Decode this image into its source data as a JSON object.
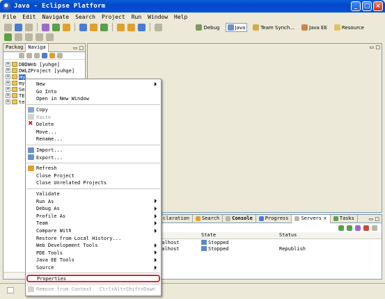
{
  "window": {
    "title": "Java - Eclipse Platform"
  },
  "menubar": [
    "File",
    "Edit",
    "Navigate",
    "Search",
    "Project",
    "Run",
    "Window",
    "Help"
  ],
  "perspectives": [
    {
      "label": "Debug",
      "active": false
    },
    {
      "label": "Java",
      "active": true
    },
    {
      "label": "Team Synch...",
      "active": false
    },
    {
      "label": "Java EE",
      "active": false
    },
    {
      "label": "Resource",
      "active": false
    }
  ],
  "left_panel": {
    "tabs": [
      "Packag",
      "Naviga"
    ],
    "tree": [
      {
        "label": "DBDWeb  [yuhge]"
      },
      {
        "label": "DWLZProject  [yuhge]"
      },
      {
        "label": "my"
      },
      {
        "label": "my"
      },
      {
        "label": "Se"
      },
      {
        "label": "TE"
      },
      {
        "label": "te"
      }
    ]
  },
  "bottom_panel": {
    "tabs": [
      {
        "label": "claration",
        "active": false
      },
      {
        "label": "Search",
        "active": false
      },
      {
        "label": "Console",
        "active": false
      },
      {
        "label": "Progress",
        "active": false
      },
      {
        "label": "Servers",
        "active": true
      },
      {
        "label": "Tasks",
        "active": false
      }
    ],
    "columns": [
      "",
      "State",
      "Status"
    ],
    "rows": [
      {
        "server": "calhost",
        "state": "Stopped",
        "status": ""
      },
      {
        "server": "calhost",
        "state": "Stopped",
        "status": "Republish"
      }
    ]
  },
  "context_menu": {
    "g1": {
      "new": "New",
      "go_into": "Go Into",
      "open_new_window": "Open in New Window"
    },
    "g2": {
      "copy": "Copy",
      "paste": "Paste",
      "delete": "Delete",
      "move": "Move...",
      "rename": "Rename..."
    },
    "g3": {
      "import": "Import...",
      "export": "Export..."
    },
    "g4": {
      "refresh": "Refresh",
      "close_project": "Close Project",
      "close_unrelated": "Close Unrelated Projects"
    },
    "g5": {
      "validate": "Validate",
      "run_as": "Run As",
      "debug_as": "Debug As",
      "profile_as": "Profile As",
      "team": "Team",
      "compare_with": "Compare With",
      "restore_local": "Restore from Local History...",
      "web_dev_tools": "Web Development Tools",
      "pde_tools": "PDE Tools",
      "java_ee_tools": "Java EE Tools",
      "source": "Source"
    },
    "g6": {
      "properties": "Properties"
    },
    "g7": {
      "remove_context": "Remove from Context",
      "remove_shortcut": "Ctrl+Alt+Shift+Down"
    }
  }
}
